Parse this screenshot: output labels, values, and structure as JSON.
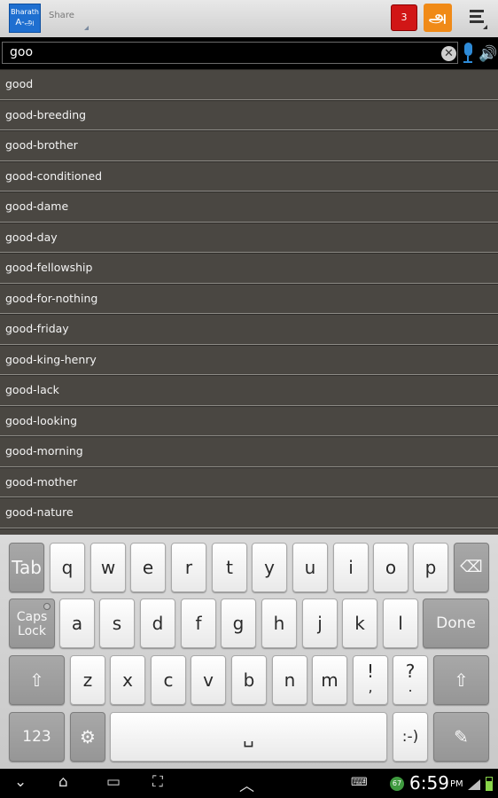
{
  "topbar": {
    "logo_line1": "Bharath",
    "logo_line2": "A-அ",
    "share_label": "Share",
    "badge_count": "3",
    "tamil_button_label": "அ",
    "colors": {
      "badge": "#d11616",
      "tamil_button": "#f08a17",
      "logo": "#1f6fd0"
    }
  },
  "search": {
    "value": "goo",
    "clear_icon": "clear-icon",
    "mic_icon": "microphone-icon",
    "speaker_icon": "speaker-icon"
  },
  "suggestions": [
    "good",
    "good-breeding",
    "good-brother",
    "good-conditioned",
    "good-dame",
    "good-day",
    "good-fellowship",
    "good-for-nothing",
    "good-friday",
    "good-king-henry",
    "good-lack",
    "good-looking",
    "good-morning",
    "good-mother",
    "good-nature",
    ""
  ],
  "keyboard": {
    "row1": [
      "Tab",
      "q",
      "w",
      "e",
      "r",
      "t",
      "y",
      "u",
      "i",
      "o",
      "p",
      "⌫"
    ],
    "row2": [
      "Caps Lock",
      "a",
      "s",
      "d",
      "f",
      "g",
      "h",
      "j",
      "k",
      "l",
      "Done"
    ],
    "row3": [
      "⇧",
      "z",
      "x",
      "c",
      "v",
      "b",
      "n",
      "m",
      "!",
      ",",
      "?",
      ".",
      "⇧"
    ],
    "row4": [
      "123",
      "⚙",
      "␣",
      ":-)",
      "✎"
    ],
    "tab_label": "Tab",
    "caps_line1": "Caps",
    "caps_line2": "Lock",
    "done_label": "Done",
    "num_label": "123",
    "smiley_label": ":-)",
    "excl_top": "!",
    "excl_bottom": ",",
    "quest_top": "?",
    "quest_bottom": "."
  },
  "status": {
    "time": "6:59",
    "ampm": "PM",
    "notification_badge": "67"
  }
}
